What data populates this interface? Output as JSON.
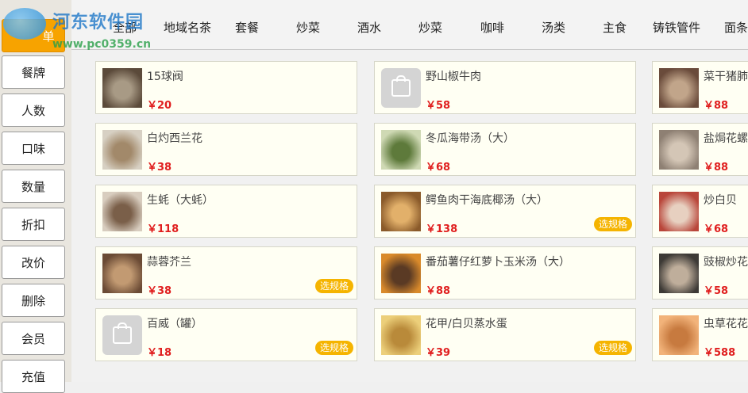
{
  "sidebar": {
    "top_label": "单",
    "buttons": [
      "餐牌",
      "人数",
      "口味",
      "数量",
      "折扣",
      "改价",
      "删除",
      "会员",
      "充值"
    ]
  },
  "watermark": {
    "title": "河东软件园",
    "url": "www.pc0359.cn"
  },
  "tabs": [
    "全部",
    "地域名茶",
    "套餐",
    "炒菜",
    "酒水",
    "炒菜",
    "咖啡",
    "汤类",
    "主食",
    "铸铁管件",
    "面条"
  ],
  "dishes": [
    {
      "name": "15球阀",
      "price": "￥20",
      "spec": "",
      "thumb": "photo"
    },
    {
      "name": "野山椒牛肉",
      "price": "￥58",
      "spec": "",
      "thumb": "placeholder"
    },
    {
      "name": "菜干猪肺",
      "price": "￥88",
      "spec": "",
      "thumb": "photo"
    },
    {
      "name": "白灼西兰花",
      "price": "￥38",
      "spec": "",
      "thumb": "photo"
    },
    {
      "name": "冬瓜海带汤（大）",
      "price": "￥68",
      "spec": "",
      "thumb": "photo"
    },
    {
      "name": "盐焗花螺",
      "price": "￥88",
      "spec": "",
      "thumb": "photo"
    },
    {
      "name": "生蚝（大蚝）",
      "price": "￥118",
      "spec": "",
      "thumb": "photo"
    },
    {
      "name": "鳄鱼肉干海底椰汤（大）",
      "price": "￥138",
      "spec": "选规格",
      "thumb": "photo"
    },
    {
      "name": "炒白贝",
      "price": "￥68",
      "spec": "",
      "thumb": "photo"
    },
    {
      "name": "蒜蓉芥兰",
      "price": "￥38",
      "spec": "选规格",
      "thumb": "photo"
    },
    {
      "name": "番茄薯仔红萝卜玉米汤（大）",
      "price": "￥88",
      "spec": "",
      "thumb": "photo"
    },
    {
      "name": "豉椒炒花",
      "price": "￥58",
      "spec": "",
      "thumb": "photo"
    },
    {
      "name": "百威（罐）",
      "price": "￥18",
      "spec": "选规格",
      "thumb": "placeholder"
    },
    {
      "name": "花甲/白贝蒸水蛋",
      "price": "￥39",
      "spec": "选规格",
      "thumb": "photo"
    },
    {
      "name": "虫草花花",
      "price": "￥588",
      "spec": "",
      "thumb": "photo"
    }
  ],
  "colors": {
    "accent": "#f7a300",
    "price": "#e01e1e",
    "spec_badge": "#f5b400",
    "card_bg": "#fffff3"
  }
}
